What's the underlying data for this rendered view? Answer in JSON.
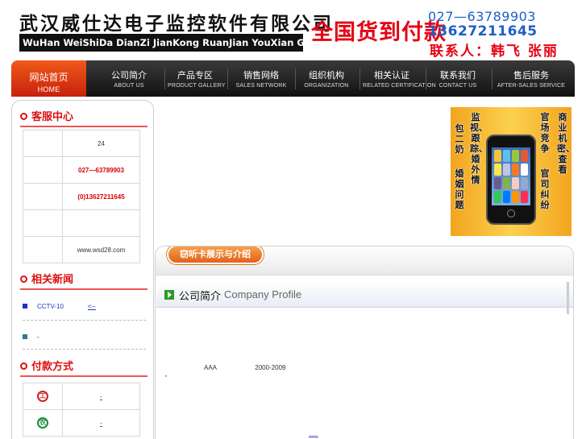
{
  "header": {
    "logo_cn": "武汉威仕达电子监控软件有限公司",
    "logo_pinyin": "WuHan WeiShiDa DianZi JianKong RuanJian YouXian GongSi",
    "delivery": "全国货到付款",
    "tel1": "027—63789903",
    "tel2": "13627211645",
    "contact": "联系人：韩飞 张丽"
  },
  "nav": {
    "items": [
      {
        "cn": "网站首页",
        "en": "HOME"
      },
      {
        "cn": "公司简介",
        "en": "ABOUT US"
      },
      {
        "cn": "产品专区",
        "en": "PRODUCT GALLERY"
      },
      {
        "cn": "销售网络",
        "en": "SALES NETWORK"
      },
      {
        "cn": "组织机构",
        "en": "ORGANIZATION"
      },
      {
        "cn": "相关认证",
        "en": "RELATED CERTIFICATION"
      },
      {
        "cn": "联系我们",
        "en": "CONTACT US"
      },
      {
        "cn": "售后服务",
        "en": "AFTER-SALES SERVICE"
      }
    ]
  },
  "sidebar": {
    "service_title": "客服中心",
    "service_rows": [
      "24",
      "027—63789903",
      "(0)13627211645",
      "",
      "www.wsd28.com"
    ],
    "news_title": "相关新闻",
    "news": [
      {
        "text": "CCTV-10",
        "tail": "<--"
      },
      {
        "text": "-",
        "tail": ""
      }
    ],
    "pay_title": "付款方式",
    "pay_rows": [
      {
        "bank": "工",
        "link": "-"
      },
      {
        "bank": "农",
        "link": "-"
      }
    ]
  },
  "promo": {
    "columns": [
      "包二奶",
      "监视、跟踪、婚外情",
      "婚姻问题",
      "官场竞争",
      "商业机密、查看",
      "官司纠纷"
    ]
  },
  "main": {
    "badge": "窃听卡展示与介绍",
    "profile_cn": "公司简介",
    "profile_en": "Company Profile",
    "intro_a": "AAA",
    "intro_b": "2000-2009",
    "quote": "\"",
    "more": "......"
  },
  "colors": {
    "accent_red": "#e60012",
    "accent_blue": "#1f5fc4",
    "nav_dark": "#111111",
    "nav_active": "#d9360f"
  }
}
